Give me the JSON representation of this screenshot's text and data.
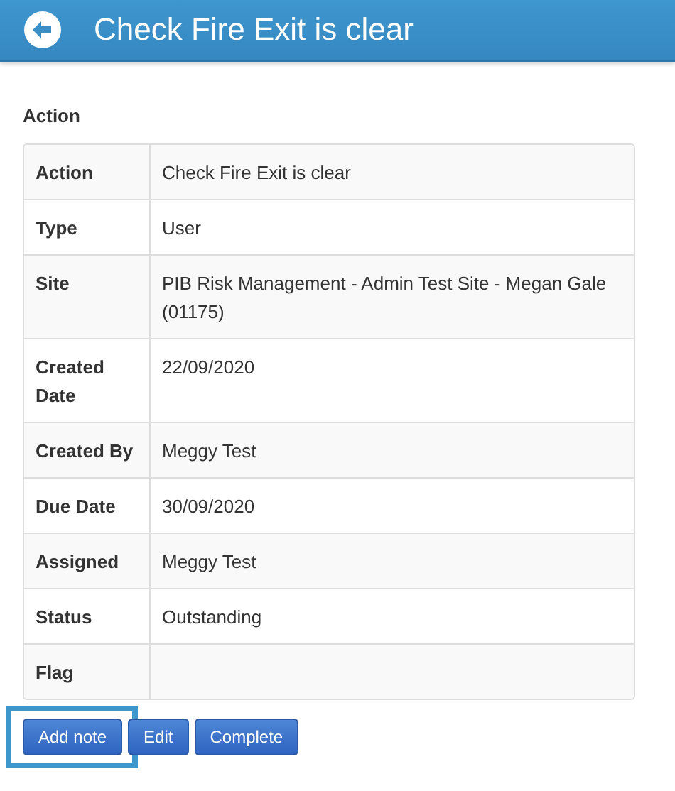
{
  "header": {
    "title": "Check Fire Exit is clear"
  },
  "section_title": "Action",
  "details": [
    {
      "label": "Action",
      "value": "Check Fire Exit is clear"
    },
    {
      "label": "Type",
      "value": "User"
    },
    {
      "label": "Site",
      "value": "PIB Risk Management - Admin Test Site - Megan Gale (01175)"
    },
    {
      "label": "Created Date",
      "value": "22/09/2020"
    },
    {
      "label": "Created By",
      "value": "Meggy Test"
    },
    {
      "label": "Due Date",
      "value": "30/09/2020"
    },
    {
      "label": "Assigned",
      "value": "Meggy Test"
    },
    {
      "label": "Status",
      "value": "Outstanding"
    },
    {
      "label": "Flag"
    }
  ],
  "buttons": [
    {
      "label": "Add note",
      "highlighted": true
    },
    {
      "label": "Edit",
      "highlighted": false
    },
    {
      "label": "Complete",
      "highlighted": false
    }
  ]
}
